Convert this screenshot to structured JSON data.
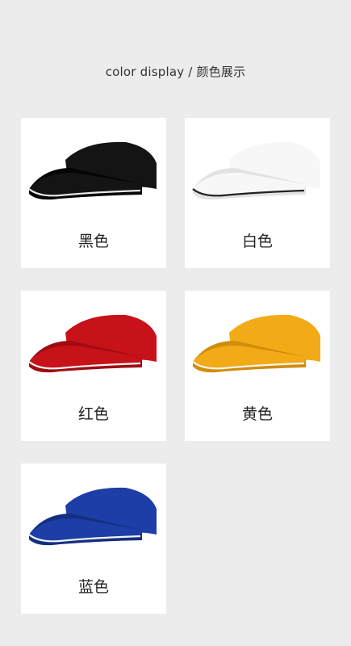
{
  "heading": "color display / 颜色展示",
  "products": [
    {
      "label": "黑色",
      "color": "#141414",
      "shade": "#050505",
      "sandwich": "#e8e8e8"
    },
    {
      "label": "白色",
      "color": "#f7f7f7",
      "shade": "#e2e2e2",
      "sandwich": "#222222"
    },
    {
      "label": "红色",
      "color": "#c8121a",
      "shade": "#9e0c12",
      "sandwich": "#f4f4f4"
    },
    {
      "label": "黄色",
      "color": "#f2aa16",
      "shade": "#d18d0a",
      "sandwich": "#f4f4f4"
    },
    {
      "label": "蓝色",
      "color": "#1c3ea6",
      "shade": "#142f80",
      "sandwich": "#f4f4f4"
    }
  ]
}
